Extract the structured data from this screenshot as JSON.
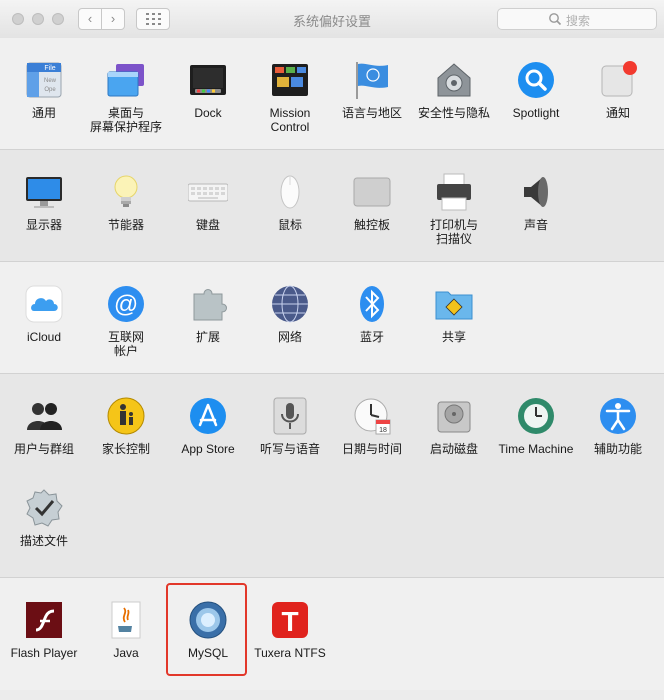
{
  "window": {
    "title": "系统偏好设置"
  },
  "search": {
    "placeholder": "搜索"
  },
  "colors": {
    "highlight": "#e2372a",
    "accent": "#1d8ef0"
  },
  "sections": [
    {
      "items": [
        {
          "label": "通用",
          "icon": "general-icon"
        },
        {
          "label": "桌面与\n屏幕保护程序",
          "icon": "desktop-icon"
        },
        {
          "label": "Dock",
          "icon": "dock-icon"
        },
        {
          "label": "Mission\nControl",
          "icon": "mission-control-icon"
        },
        {
          "label": "语言与地区",
          "icon": "language-region-icon"
        },
        {
          "label": "安全性与隐私",
          "icon": "security-icon"
        },
        {
          "label": "Spotlight",
          "icon": "spotlight-icon"
        },
        {
          "label": "通知",
          "icon": "notifications-icon"
        }
      ]
    },
    {
      "items": [
        {
          "label": "显示器",
          "icon": "display-icon"
        },
        {
          "label": "节能器",
          "icon": "energy-icon"
        },
        {
          "label": "键盘",
          "icon": "keyboard-icon"
        },
        {
          "label": "鼠标",
          "icon": "mouse-icon"
        },
        {
          "label": "触控板",
          "icon": "trackpad-icon"
        },
        {
          "label": "打印机与\n扫描仪",
          "icon": "printer-icon"
        },
        {
          "label": "声音",
          "icon": "sound-icon"
        }
      ]
    },
    {
      "items": [
        {
          "label": "iCloud",
          "icon": "icloud-icon"
        },
        {
          "label": "互联网\n帐户",
          "icon": "internet-accounts-icon"
        },
        {
          "label": "扩展",
          "icon": "extensions-icon"
        },
        {
          "label": "网络",
          "icon": "network-icon"
        },
        {
          "label": "蓝牙",
          "icon": "bluetooth-icon"
        },
        {
          "label": "共享",
          "icon": "sharing-icon"
        }
      ]
    },
    {
      "items": [
        {
          "label": "用户与群组",
          "icon": "users-icon"
        },
        {
          "label": "家长控制",
          "icon": "parental-icon"
        },
        {
          "label": "App Store",
          "icon": "appstore-icon"
        },
        {
          "label": "听写与语音",
          "icon": "dictation-icon"
        },
        {
          "label": "日期与时间",
          "icon": "datetime-icon"
        },
        {
          "label": "启动磁盘",
          "icon": "startup-disk-icon"
        },
        {
          "label": "Time Machine",
          "icon": "timemachine-icon"
        },
        {
          "label": "辅助功能",
          "icon": "accessibility-icon"
        },
        {
          "label": "描述文件",
          "icon": "profiles-icon"
        }
      ]
    },
    {
      "items": [
        {
          "label": "Flash Player",
          "icon": "flash-icon"
        },
        {
          "label": "Java",
          "icon": "java-icon"
        },
        {
          "label": "MySQL",
          "icon": "mysql-icon"
        },
        {
          "label": "Tuxera NTFS",
          "icon": "tuxera-icon"
        }
      ]
    }
  ]
}
